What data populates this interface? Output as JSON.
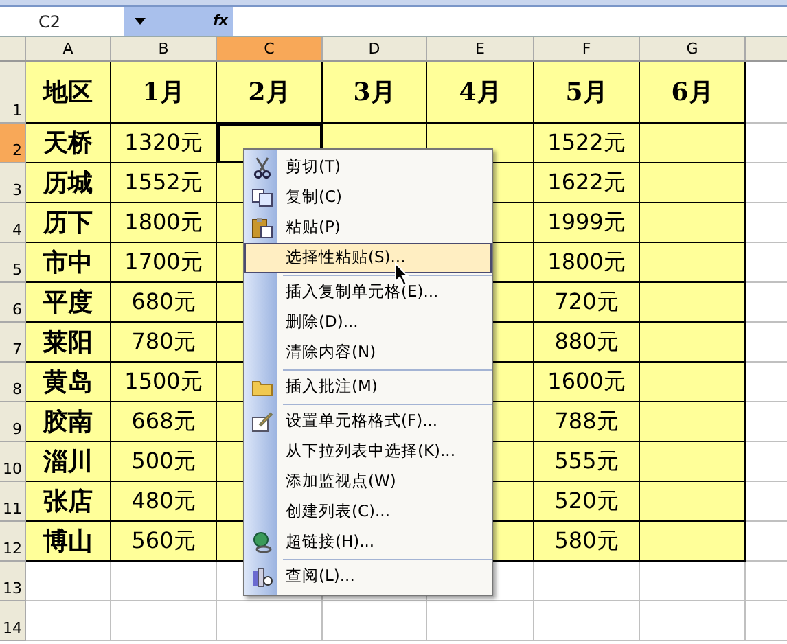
{
  "name_box": "C2",
  "formula_icon": "fx",
  "columns": [
    {
      "label": "A",
      "selected": false
    },
    {
      "label": "B",
      "selected": false
    },
    {
      "label": "C",
      "selected": true
    },
    {
      "label": "D",
      "selected": false
    },
    {
      "label": "E",
      "selected": false
    },
    {
      "label": "F",
      "selected": false
    },
    {
      "label": "G",
      "selected": false
    }
  ],
  "rows": [
    {
      "number": "1",
      "selected": false,
      "kind": "header",
      "cells": {
        "a": "地区",
        "b": "1月",
        "c": "2月",
        "d": "3月",
        "e": "4月",
        "f": "5月",
        "g": "6月"
      }
    },
    {
      "number": "2",
      "selected": true,
      "cells": {
        "a": "天桥",
        "b": "1320元",
        "f": "1522元"
      }
    },
    {
      "number": "3",
      "selected": false,
      "cells": {
        "a": "历城",
        "b": "1552元",
        "f": "1622元"
      }
    },
    {
      "number": "4",
      "selected": false,
      "cells": {
        "a": "历下",
        "b": "1800元",
        "f": "1999元"
      }
    },
    {
      "number": "5",
      "selected": false,
      "cells": {
        "a": "市中",
        "b": "1700元",
        "f": "1800元"
      }
    },
    {
      "number": "6",
      "selected": false,
      "cells": {
        "a": "平度",
        "b": "680元",
        "f": "720元"
      }
    },
    {
      "number": "7",
      "selected": false,
      "cells": {
        "a": "莱阳",
        "b": "780元",
        "f": "880元"
      }
    },
    {
      "number": "8",
      "selected": false,
      "cells": {
        "a": "黄岛",
        "b": "1500元",
        "f": "1600元"
      }
    },
    {
      "number": "9",
      "selected": false,
      "cells": {
        "a": "胶南",
        "b": "668元",
        "f": "788元"
      }
    },
    {
      "number": "10",
      "selected": false,
      "cells": {
        "a": "淄川",
        "b": "500元",
        "f": "555元"
      }
    },
    {
      "number": "11",
      "selected": false,
      "cells": {
        "a": "张店",
        "b": "480元",
        "f": "520元"
      }
    },
    {
      "number": "12",
      "selected": false,
      "cells": {
        "a": "博山",
        "b": "560元",
        "f": "580元"
      }
    },
    {
      "number": "13",
      "selected": false,
      "kind": "blank",
      "cells": {}
    },
    {
      "number": "14",
      "selected": false,
      "kind": "blank",
      "cells": {}
    }
  ],
  "context_menu": [
    {
      "label": "剪切(T)",
      "kind": "cut",
      "selected": false
    },
    {
      "label": "复制(C)",
      "kind": "copy",
      "selected": false
    },
    {
      "label": "粘贴(P)",
      "kind": "paste",
      "selected": false
    },
    {
      "label": "选择性粘贴(S)...",
      "kind": "plain",
      "selected": true
    },
    {
      "kind": "separator"
    },
    {
      "label": "插入复制单元格(E)...",
      "kind": "plain",
      "selected": false
    },
    {
      "label": "删除(D)...",
      "kind": "plain",
      "selected": false
    },
    {
      "label": "清除内容(N)",
      "kind": "plain",
      "selected": false
    },
    {
      "kind": "separator"
    },
    {
      "label": "插入批注(M)",
      "kind": "comment",
      "selected": false
    },
    {
      "kind": "separator"
    },
    {
      "label": "设置单元格格式(F)...",
      "kind": "format",
      "selected": false
    },
    {
      "label": "从下拉列表中选择(K)...",
      "kind": "plain",
      "selected": false
    },
    {
      "label": "添加监视点(W)",
      "kind": "plain",
      "selected": false
    },
    {
      "label": "创建列表(C)...",
      "kind": "plain",
      "selected": false
    },
    {
      "label": "超链接(H)...",
      "kind": "link",
      "selected": false
    },
    {
      "kind": "separator"
    },
    {
      "label": "查阅(L)...",
      "kind": "lookup",
      "selected": false
    }
  ]
}
